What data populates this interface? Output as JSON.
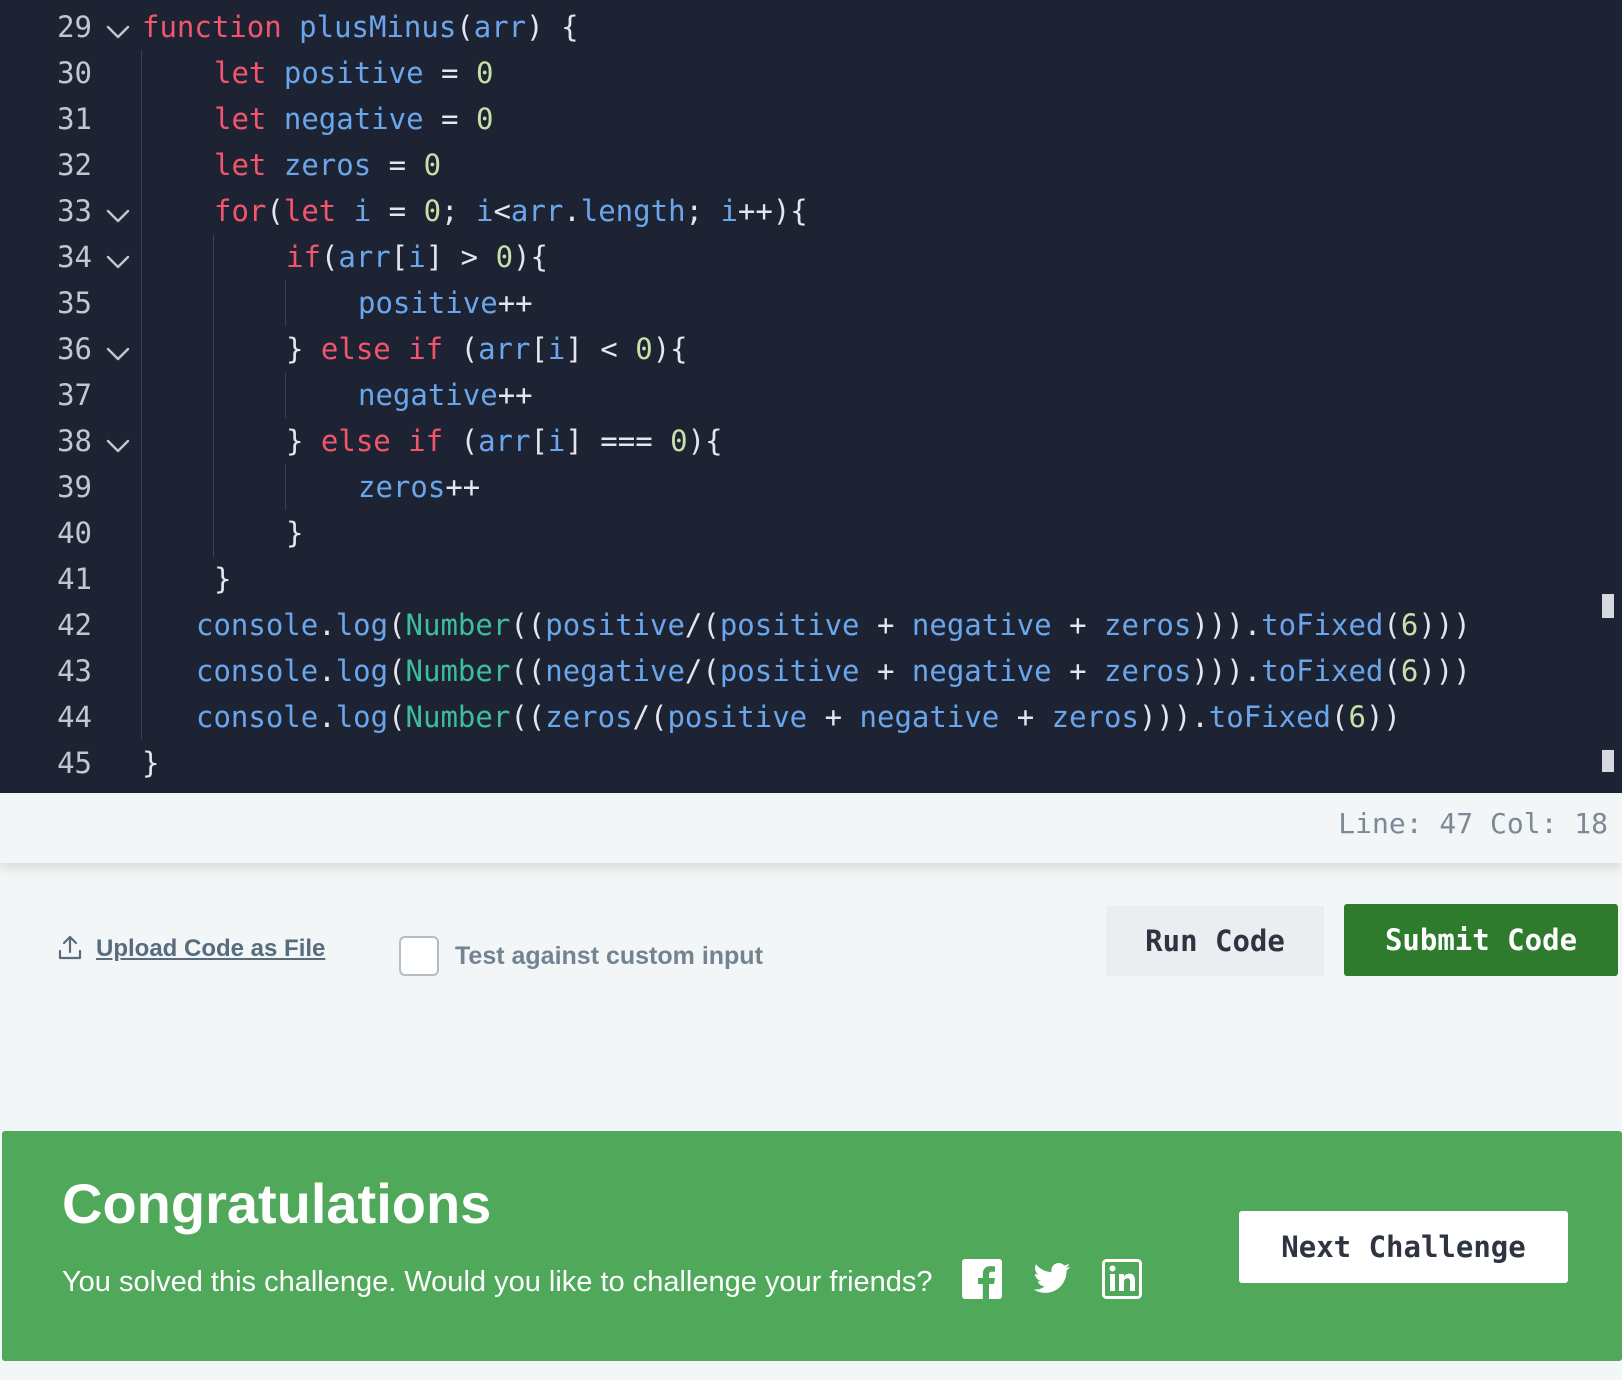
{
  "editor": {
    "lines": [
      {
        "n": "29",
        "fold": true,
        "indent": 0,
        "tokens": [
          [
            "kw",
            "function"
          ],
          [
            "op",
            " "
          ],
          [
            "id",
            "plusMinus"
          ],
          [
            "op",
            "("
          ],
          [
            "id",
            "arr"
          ],
          [
            "op",
            ") {"
          ]
        ]
      },
      {
        "n": "30",
        "fold": false,
        "indent": 1,
        "tokens": [
          [
            "kw",
            "let"
          ],
          [
            "op",
            " "
          ],
          [
            "id",
            "positive"
          ],
          [
            "op",
            " = "
          ],
          [
            "num",
            "0"
          ]
        ]
      },
      {
        "n": "31",
        "fold": false,
        "indent": 1,
        "tokens": [
          [
            "kw",
            "let"
          ],
          [
            "op",
            " "
          ],
          [
            "id",
            "negative"
          ],
          [
            "op",
            " = "
          ],
          [
            "num",
            "0"
          ]
        ]
      },
      {
        "n": "32",
        "fold": false,
        "indent": 1,
        "tokens": [
          [
            "kw",
            "let"
          ],
          [
            "op",
            " "
          ],
          [
            "id",
            "zeros"
          ],
          [
            "op",
            " = "
          ],
          [
            "num",
            "0"
          ]
        ]
      },
      {
        "n": "33",
        "fold": true,
        "indent": 1,
        "tokens": [
          [
            "kw",
            "for"
          ],
          [
            "op",
            "("
          ],
          [
            "kw",
            "let"
          ],
          [
            "op",
            " "
          ],
          [
            "id",
            "i"
          ],
          [
            "op",
            " = "
          ],
          [
            "num",
            "0"
          ],
          [
            "op",
            "; "
          ],
          [
            "id",
            "i"
          ],
          [
            "op",
            "<"
          ],
          [
            "id",
            "arr"
          ],
          [
            "op",
            "."
          ],
          [
            "id",
            "length"
          ],
          [
            "op",
            "; "
          ],
          [
            "id",
            "i"
          ],
          [
            "op",
            "++){"
          ]
        ]
      },
      {
        "n": "34",
        "fold": true,
        "indent": 2,
        "tokens": [
          [
            "kw",
            "if"
          ],
          [
            "op",
            "("
          ],
          [
            "id",
            "arr"
          ],
          [
            "op",
            "["
          ],
          [
            "id",
            "i"
          ],
          [
            "op",
            "] > "
          ],
          [
            "num",
            "0"
          ],
          [
            "op",
            "){"
          ]
        ]
      },
      {
        "n": "35",
        "fold": false,
        "indent": 3,
        "tokens": [
          [
            "id",
            "positive"
          ],
          [
            "op",
            "++"
          ]
        ]
      },
      {
        "n": "36",
        "fold": true,
        "indent": 2,
        "tokens": [
          [
            "op",
            "} "
          ],
          [
            "kw",
            "else if"
          ],
          [
            "op",
            " ("
          ],
          [
            "id",
            "arr"
          ],
          [
            "op",
            "["
          ],
          [
            "id",
            "i"
          ],
          [
            "op",
            "] < "
          ],
          [
            "num",
            "0"
          ],
          [
            "op",
            "){"
          ]
        ]
      },
      {
        "n": "37",
        "fold": false,
        "indent": 3,
        "tokens": [
          [
            "id",
            "negative"
          ],
          [
            "op",
            "++"
          ]
        ]
      },
      {
        "n": "38",
        "fold": true,
        "indent": 2,
        "tokens": [
          [
            "op",
            "} "
          ],
          [
            "kw",
            "else if"
          ],
          [
            "op",
            " ("
          ],
          [
            "id",
            "arr"
          ],
          [
            "op",
            "["
          ],
          [
            "id",
            "i"
          ],
          [
            "op",
            "] === "
          ],
          [
            "num",
            "0"
          ],
          [
            "op",
            "){"
          ]
        ]
      },
      {
        "n": "39",
        "fold": false,
        "indent": 3,
        "tokens": [
          [
            "id",
            "zeros"
          ],
          [
            "op",
            "++"
          ]
        ]
      },
      {
        "n": "40",
        "fold": false,
        "indent": 2,
        "tokens": [
          [
            "op",
            "}"
          ]
        ]
      },
      {
        "n": "41",
        "fold": false,
        "indent": 1,
        "tokens": [
          [
            "op",
            "}"
          ]
        ]
      },
      {
        "n": "42",
        "fold": false,
        "indent": 0.75,
        "tokens": [
          [
            "id",
            "console"
          ],
          [
            "op",
            "."
          ],
          [
            "id",
            "log"
          ],
          [
            "op",
            "("
          ],
          [
            "cls",
            "Number"
          ],
          [
            "op",
            "(("
          ],
          [
            "id",
            "positive"
          ],
          [
            "op",
            "/("
          ],
          [
            "id",
            "positive"
          ],
          [
            "op",
            " + "
          ],
          [
            "id",
            "negative"
          ],
          [
            "op",
            " + "
          ],
          [
            "id",
            "zeros"
          ],
          [
            "op",
            ")))."
          ],
          [
            "id",
            "toFixed"
          ],
          [
            "op",
            "("
          ],
          [
            "num",
            "6"
          ],
          [
            "op",
            ")))"
          ]
        ]
      },
      {
        "n": "43",
        "fold": false,
        "indent": 0.75,
        "tokens": [
          [
            "id",
            "console"
          ],
          [
            "op",
            "."
          ],
          [
            "id",
            "log"
          ],
          [
            "op",
            "("
          ],
          [
            "cls",
            "Number"
          ],
          [
            "op",
            "(("
          ],
          [
            "id",
            "negative"
          ],
          [
            "op",
            "/("
          ],
          [
            "id",
            "positive"
          ],
          [
            "op",
            " + "
          ],
          [
            "id",
            "negative"
          ],
          [
            "op",
            " + "
          ],
          [
            "id",
            "zeros"
          ],
          [
            "op",
            ")))."
          ],
          [
            "id",
            "toFixed"
          ],
          [
            "op",
            "("
          ],
          [
            "num",
            "6"
          ],
          [
            "op",
            ")))"
          ]
        ]
      },
      {
        "n": "44",
        "fold": false,
        "indent": 0.75,
        "tokens": [
          [
            "id",
            "console"
          ],
          [
            "op",
            "."
          ],
          [
            "id",
            "log"
          ],
          [
            "op",
            "("
          ],
          [
            "cls",
            "Number"
          ],
          [
            "op",
            "(("
          ],
          [
            "id",
            "zeros"
          ],
          [
            "op",
            "/("
          ],
          [
            "id",
            "positive"
          ],
          [
            "op",
            " + "
          ],
          [
            "id",
            "negative"
          ],
          [
            "op",
            " + "
          ],
          [
            "id",
            "zeros"
          ],
          [
            "op",
            ")))."
          ],
          [
            "id",
            "toFixed"
          ],
          [
            "op",
            "("
          ],
          [
            "num",
            "6"
          ],
          [
            "op",
            "))"
          ]
        ]
      },
      {
        "n": "45",
        "fold": false,
        "indent": 0,
        "tokens": [
          [
            "op",
            "}"
          ]
        ]
      }
    ]
  },
  "status": {
    "position": "Line: 47 Col: 18"
  },
  "toolbar": {
    "upload_label": "Upload Code as File",
    "custom_input_label": "Test against custom input",
    "custom_input_checked": false,
    "run_label": "Run Code",
    "submit_label": "Submit Code"
  },
  "banner": {
    "title": "Congratulations",
    "message": "You solved this challenge. Would you like to challenge your friends?",
    "share_icons": [
      "facebook-icon",
      "twitter-icon",
      "linkedin-icon"
    ],
    "next_label": "Next Challenge"
  },
  "colors": {
    "editor_bg": "#1e2334",
    "keyword": "#f2556c",
    "identifier": "#6aa6ec",
    "number": "#c6e0a8",
    "builtin": "#3dbca0",
    "submit_green": "#2e7b2e",
    "banner_green": "#50a85a"
  }
}
